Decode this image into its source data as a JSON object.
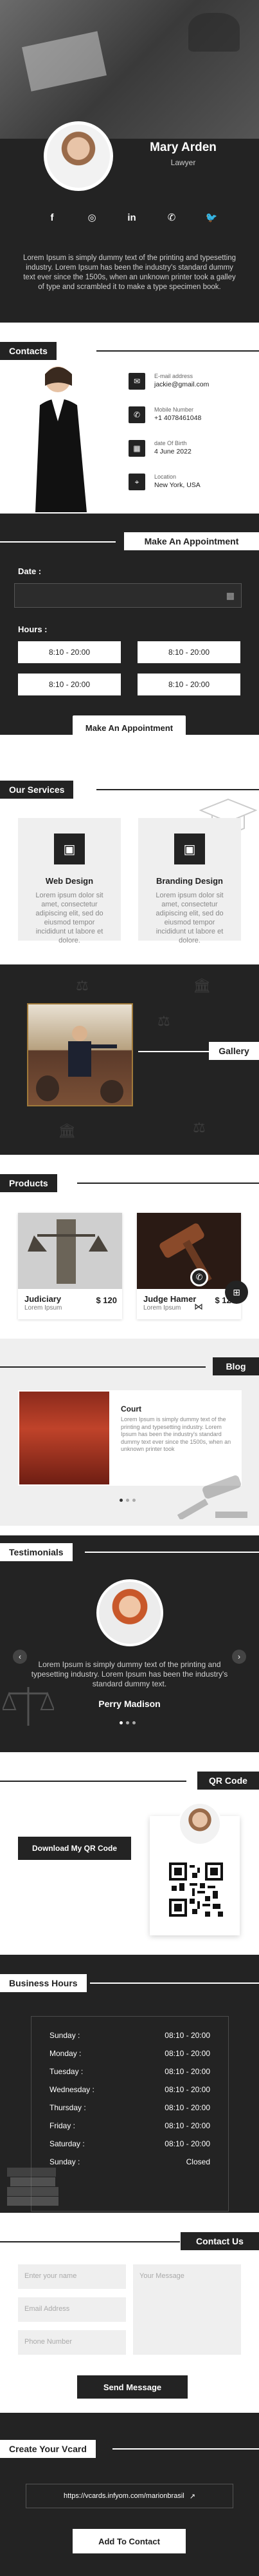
{
  "profile": {
    "name": "Mary Arden",
    "title": "Lawyer",
    "description": "Lorem Ipsum is simply dummy text of the printing and typesetting industry. Lorem Ipsum has been the industry's standard dummy text ever since the 1500s, when an unknown printer took a galley of type and scrambled it to make a type specimen book.",
    "socials": [
      {
        "icon": "facebook-icon",
        "glyph": "f"
      },
      {
        "icon": "instagram-icon",
        "glyph": "◎"
      },
      {
        "icon": "linkedin-icon",
        "glyph": "in"
      },
      {
        "icon": "whatsapp-icon",
        "glyph": "✆"
      },
      {
        "icon": "twitter-icon",
        "glyph": "🐦"
      }
    ]
  },
  "contacts": {
    "title": "Contacts",
    "items": [
      {
        "icon": "email-icon",
        "glyph": "✉",
        "label": "E-mail address",
        "value": "jackie@gmail.com"
      },
      {
        "icon": "phone-icon",
        "glyph": "✆",
        "label": "Mobile Number",
        "value": "+1 4078461048"
      },
      {
        "icon": "calendar-icon",
        "glyph": "▦",
        "label": "date Of Birth",
        "value": "4 June 2022"
      },
      {
        "icon": "location-icon",
        "glyph": "⌖",
        "label": "Location",
        "value": "New York, USA"
      }
    ]
  },
  "appointment": {
    "title": "Make An Appointment",
    "date_label": "Date :",
    "hours_label": "Hours :",
    "slots": [
      "8:10 - 20:00",
      "8:10 - 20:00",
      "8:10 - 20:00",
      "8:10 - 20:00"
    ],
    "button": "Make An Appointment"
  },
  "services": {
    "title": "Our Services",
    "items": [
      {
        "name": "Web Design",
        "icon": "image-icon",
        "glyph": "▣",
        "desc": "Lorem ipsum dolor sit amet, consectetur adipiscing elit, sed do eiusmod tempor incididunt ut labore et dolore."
      },
      {
        "name": "Branding Design",
        "icon": "image-icon",
        "glyph": "▣",
        "desc": "Lorem ipsum dolor sit amet, consectetur adipiscing elit, sed do eiusmod tempor incididunt ut labore et dolore."
      }
    ]
  },
  "gallery": {
    "title": "Gallery"
  },
  "products": {
    "title": "Products",
    "items": [
      {
        "name": "Judiciary",
        "sub": "Lorem Ipsum",
        "price": "$ 120"
      },
      {
        "name": "Judge Hamer",
        "sub": "Lorem Ipsum",
        "price": "$ 120"
      }
    ]
  },
  "blog": {
    "title": "Blog",
    "post_title": "Court",
    "post_text": "Lorem Ipsum is simply dummy text of the printing and typesetting industry. Lorem Ipsum has been the industry's standard dummy text ever since the 1500s, when an unknown printer took"
  },
  "testimonials": {
    "title": "Testimonials",
    "text": "Lorem Ipsum is simply dummy text of the printing and typesetting industry. Lorem Ipsum has been the industry's standard dummy text.",
    "name": "Perry Madison"
  },
  "qr": {
    "title": "QR Code",
    "button": "Download My QR Code"
  },
  "hours": {
    "title": "Business Hours",
    "rows": [
      {
        "day": "Sunday :",
        "time": "08:10 - 20:00"
      },
      {
        "day": "Monday :",
        "time": "08:10 - 20:00"
      },
      {
        "day": "Tuesday :",
        "time": "08:10 - 20:00"
      },
      {
        "day": "Wednesday :",
        "time": "08:10 - 20:00"
      },
      {
        "day": "Thursday :",
        "time": "08:10 - 20:00"
      },
      {
        "day": "Friday :",
        "time": "08:10 - 20:00"
      },
      {
        "day": "Saturday :",
        "time": "08:10 - 20:00"
      },
      {
        "day": "Sunday :",
        "time": "Closed"
      }
    ]
  },
  "contact_us": {
    "title": "Contact Us",
    "name_placeholder": "Enter your name",
    "message_placeholder": "Your Message",
    "email_placeholder": "Email Address",
    "phone_placeholder": "Phone Number",
    "button": "Send Message"
  },
  "vcard": {
    "title": "Create Your Vcard",
    "url": "https://vcards.infyom.com/marionbrasil",
    "button": "Add To Contact"
  },
  "colors": {
    "dark": "#232323",
    "light": "#ffffff",
    "grey": "#efefef"
  }
}
